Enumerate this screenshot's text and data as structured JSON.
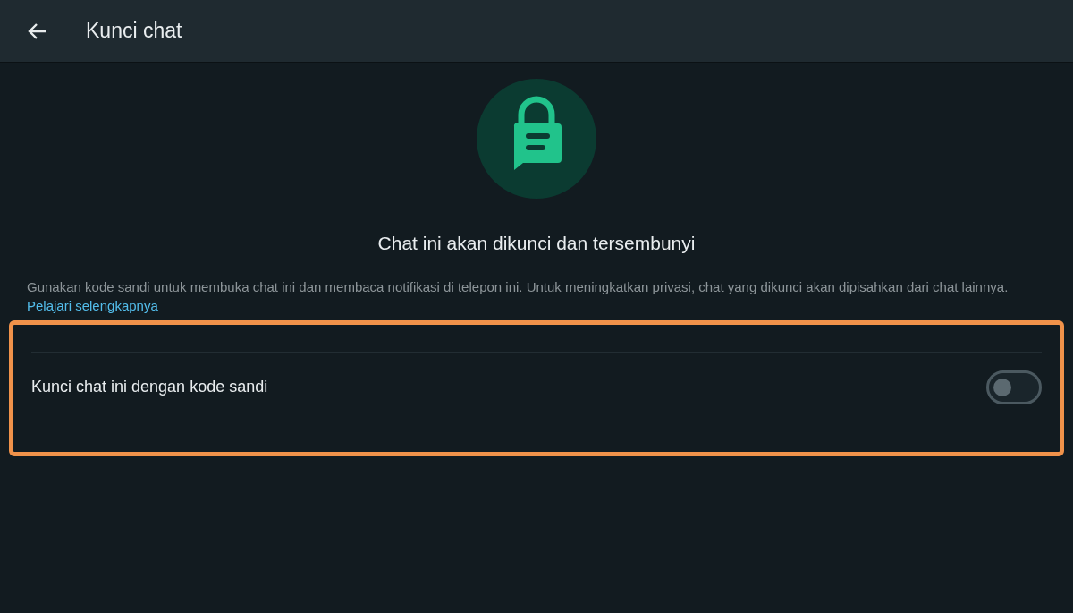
{
  "header": {
    "title": "Kunci chat"
  },
  "heading": "Chat ini akan dikunci dan tersembunyi",
  "description": {
    "text": "Gunakan kode sandi untuk membuka chat ini dan membaca notifikasi di telepon ini. Untuk meningkatkan privasi, chat yang dikunci akan dipisahkan dari chat lainnya.",
    "link": "Pelajari selengkapnya"
  },
  "highlight": {
    "shown": true
  },
  "setting": {
    "label": "Kunci chat ini dengan kode sandi",
    "on": false
  }
}
